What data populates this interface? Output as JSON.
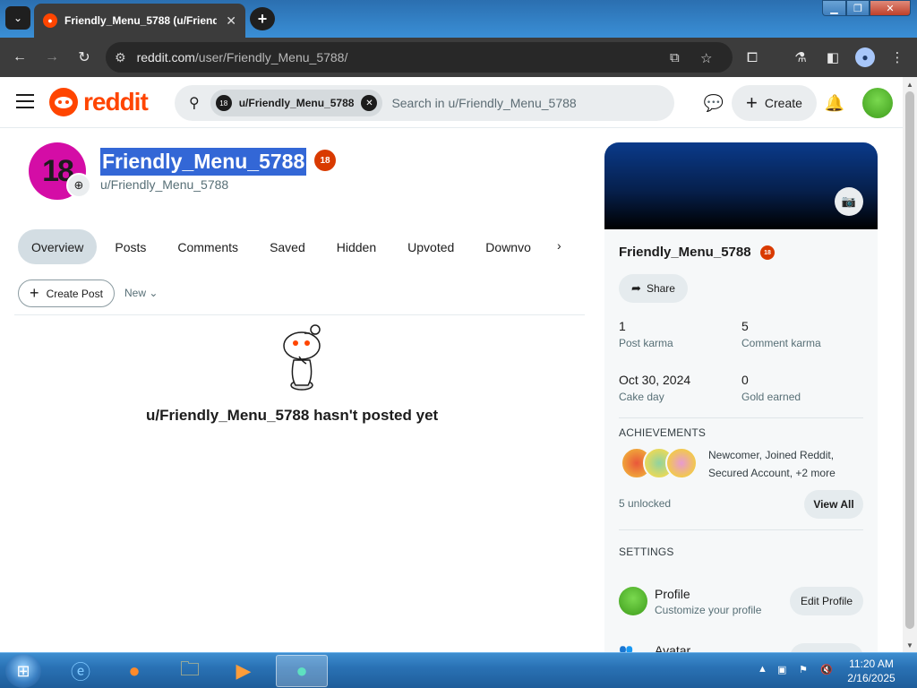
{
  "browser": {
    "tab_title": "Friendly_Menu_5788 (u/Friend",
    "tab_close": "✕",
    "url_host": "reddit.com",
    "url_path": "/user/Friendly_Menu_5788/"
  },
  "header": {
    "logo_text": "reddit",
    "search_chip": "u/Friendly_Menu_5788",
    "search_chip_avatar": "18",
    "search_placeholder": "Search in u/Friendly_Menu_5788",
    "create_label": "Create"
  },
  "profile": {
    "avatar_text": "18",
    "display_name": "Friendly_Menu_5788",
    "badge": "18",
    "handle": "u/Friendly_Menu_5788",
    "tabs": [
      "Overview",
      "Posts",
      "Comments",
      "Saved",
      "Hidden",
      "Upvoted",
      "Downvo"
    ],
    "active_tab": "Overview",
    "create_post_label": "Create Post",
    "sort_label": "New",
    "empty_message": "u/Friendly_Menu_5788 hasn't posted yet"
  },
  "sidebar": {
    "name": "Friendly_Menu_5788",
    "badge": "18",
    "share_label": "Share",
    "stats": [
      {
        "value": "1",
        "label": "Post karma"
      },
      {
        "value": "5",
        "label": "Comment karma"
      },
      {
        "value": "Oct 30, 2024",
        "label": "Cake day"
      },
      {
        "value": "0",
        "label": "Gold earned"
      }
    ],
    "achievements_title": "ACHIEVEMENTS",
    "achievements_line1": "Newcomer, Joined Reddit,",
    "achievements_line2": "Secured Account, +2 more",
    "unlocked": "5 unlocked",
    "view_all_label": "View All",
    "settings_title": "SETTINGS",
    "profile_setting_title": "Profile",
    "profile_setting_sub": "Customize your profile",
    "edit_profile_label": "Edit Profile",
    "partial_setting_title": "Avatar"
  },
  "taskbar": {
    "time": "11:20 AM",
    "date": "2/16/2025"
  },
  "colors": {
    "reddit_orange": "#ff4500",
    "selection_blue": "#3367d6",
    "active_tab_bg": "#d3dde3",
    "sidebar_bg": "#f6f8f9"
  }
}
